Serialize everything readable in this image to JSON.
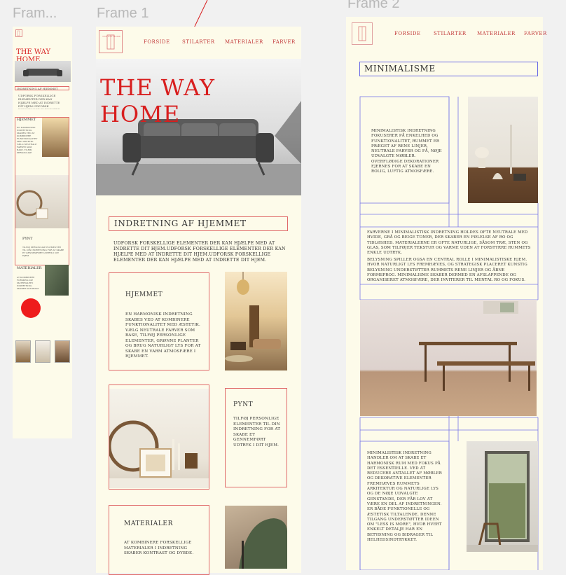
{
  "frames": {
    "left_label": "Fram...",
    "frame1_label": "Frame 1",
    "frame2_label": "Frame 2"
  },
  "nav": [
    "FORSIDE",
    "STILARTER",
    "MATERIALER",
    "FARVER"
  ],
  "hero": {
    "title": "THE WAY HOME"
  },
  "frame1": {
    "section_title": "INDRETNING AF HJEMMET",
    "intro": "Udforsk forskellige elementer der kan hjælpe med at indrette dit hjem.Udforsk forskellige elementer der kan hjælpe med at indrette dit hjem.Udforsk forskellige elementer der kan hjælpe med at indrette dit hjem.",
    "cards": [
      {
        "title": "HJEMMET",
        "text": "En harmonisk indretning skabes ved at kombinere funktionalitet med æstetik. Vælg neutrale farver som base, tilføj personlige elementer, grønne planter og brug naturligt lys for at skabe en varm atmosfære i hjemmet."
      },
      {
        "title": "PYNT",
        "text": "Tilføj personlige elementer til din indretning for at skabe et gennemført udtryk i dit hjem."
      },
      {
        "title": "MATERIALER",
        "text": "At kombinere forskellige materialer i indretning skaber kontrast og dybde."
      }
    ]
  },
  "frame2": {
    "section_title": "MINIMALISME",
    "text1": "Minimalistisk indretning fokuserer på enkelhed og funktionalitet, rummet er præget af rene linjer, neutrale farver og få, nøje udvalgte møbler. Overflødige dekorationer fjernes for at skabe en rolig, luftig atmosfære.",
    "text2": "Farverne i minimalistisk indretning holdes ofte neutrale med hvide, grå og beige toner, der skaber en følelse af ro og tidløshed. Materialerne er ofte naturlige, såsom træ, sten og glas, som tilføjer tekstur og varme uden at forstyrre rummets enkle udtryk.",
    "text3": "Belysning spiller også en central rolle i minimalistiske hjem. Hvor naturligt lys fremhæves, og strategisk placeret kunstig belysning understøtter rummets rene linjer og åbne formsprog. Minimalisme skaber dermed en afslappende og organiseret atmosfære, der inviterer til mental ro og fokus.",
    "text4": "Minimalistisk indretning handler om at skabe et harmonisk rum med fokus på det essentielle. Ved at reducere antallet af møbler og dekorative elementer fremhæves rummets arkitektur og naturlige lys og de nøje udvalgte genstande, der får lov at være en del af indretningen. Er både funktionelle og æstetisk tiltalende. Denne tilgang understøtter ideen om \"less is more\", hvor hvert enkelt detalje har en betydning og bidrager til helhedsindtrykket."
  },
  "colors": {
    "accent": "#d81e1e",
    "frame_bg": "#fdfbea",
    "guide_blue": "#6a6ae6",
    "guide_red": "#e06a6a"
  }
}
